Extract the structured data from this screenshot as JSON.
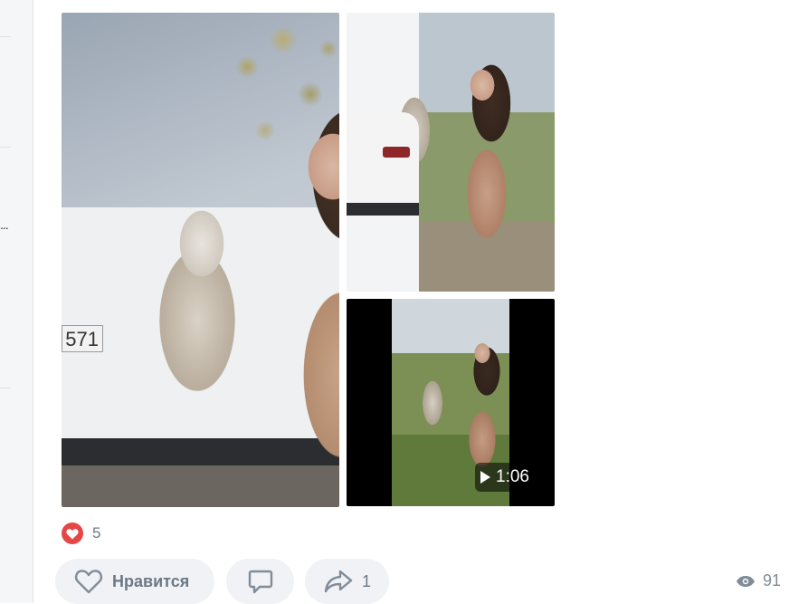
{
  "sidebar": {
    "more_label": "..."
  },
  "post": {
    "photos": [
      {
        "plate_text": "571"
      },
      {},
      {
        "duration": "1:06"
      }
    ],
    "reactions": {
      "count": "5"
    },
    "actions": {
      "like_label": "Нравится",
      "share_count": "1"
    },
    "views": {
      "count": "91"
    }
  },
  "colors": {
    "heart": "#e64646",
    "pill_bg": "#f0f2f5",
    "muted_text": "#6d7885"
  },
  "icons": {
    "heart": "heart-icon",
    "like": "heart-outline-icon",
    "comment": "comment-icon",
    "share": "share-icon",
    "views": "eye-icon",
    "play": "play-icon"
  }
}
